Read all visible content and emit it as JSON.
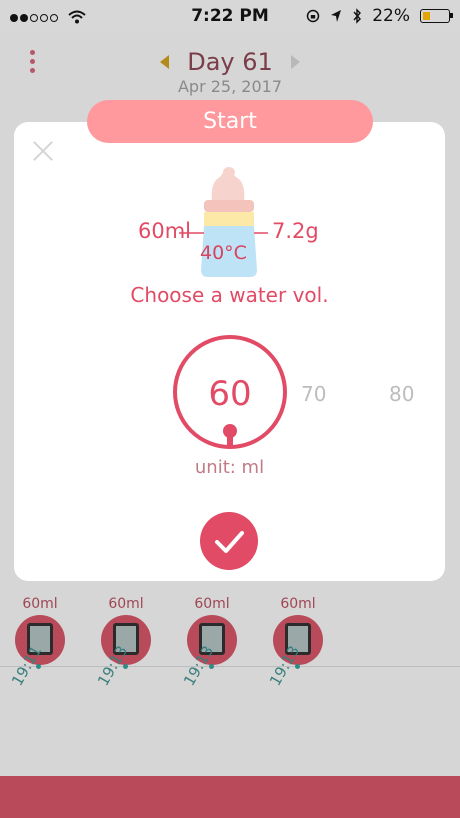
{
  "status_bar": {
    "time": "7:22 PM",
    "battery": "22%",
    "signal_dots_filled": 2,
    "signal_dots_total": 5
  },
  "header": {
    "day_title": "Day 61",
    "date": "Apr 25, 2017"
  },
  "start_button": {
    "label": "Start"
  },
  "modal": {
    "bottle": {
      "water_volume_label": "60ml",
      "formula_weight_label": "7.2g",
      "temperature_label": "40°C"
    },
    "prompt": "Choose a water vol.",
    "picker": {
      "selected": "60",
      "options": [
        "70",
        "80"
      ],
      "unit_label": "unit: ml"
    }
  },
  "history": {
    "entries": [
      {
        "volume": "60ml",
        "time": "19:11"
      },
      {
        "volume": "60ml",
        "time": "19:13"
      },
      {
        "volume": "60ml",
        "time": "19:13"
      },
      {
        "volume": "60ml",
        "time": "19:13"
      }
    ]
  },
  "colors": {
    "accent": "#e24b65",
    "start_button": "#ff999d",
    "footer": "#b84a5a"
  },
  "icons": {
    "menu": "vertical-dots-icon",
    "close": "close-icon",
    "confirm": "checkmark-icon",
    "bottle": "baby-bottle-icon",
    "cup": "cup-icon"
  }
}
